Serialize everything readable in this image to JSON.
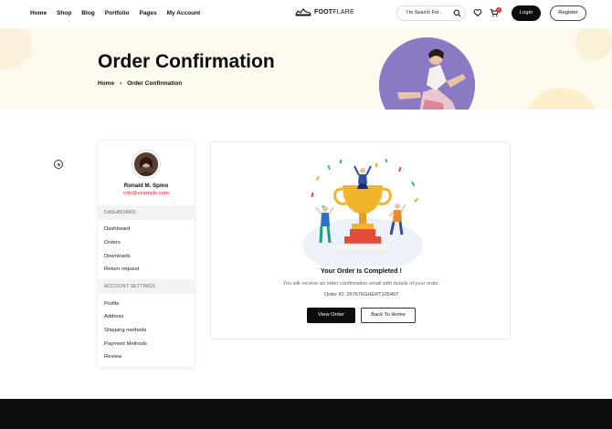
{
  "nav": {
    "links": [
      "Home",
      "Shop",
      "Blog",
      "Portfolio",
      "Pages",
      "My Account"
    ],
    "logo_bold": "FOOT",
    "logo_light": "FLARE",
    "search_placeholder": "I'm Search For..",
    "cart_count": "0",
    "login_label": "Login",
    "register_label": "Register"
  },
  "hero": {
    "title": "Order Confirmation",
    "breadcrumb": [
      "Home",
      "Order Confirmation"
    ]
  },
  "sidebar": {
    "user_name": "Ronald M. Spino",
    "user_email": "info@example.com",
    "dashboard_heading": "DASHBOARD",
    "dashboard_items": [
      "Dashboard",
      "Orders",
      "Downloads",
      "Return request"
    ],
    "settings_heading": "ACCOUNT SETTINGS",
    "settings_items": [
      "Profile",
      "Address",
      "Shipping methods",
      "Payment Methods",
      "Review"
    ]
  },
  "confirmation": {
    "title": "Your Order Is Completed !",
    "subtitle": "You will receive an order confirmation email with details of your order.",
    "order_id": "Order ID: 267676GHERT105467",
    "view_order_label": "View Order",
    "back_home_label": "Back To Home"
  },
  "colors": {
    "accent": "#e6272c",
    "dark": "#0d0d0d",
    "hero_bg": "#fdf9ee"
  }
}
